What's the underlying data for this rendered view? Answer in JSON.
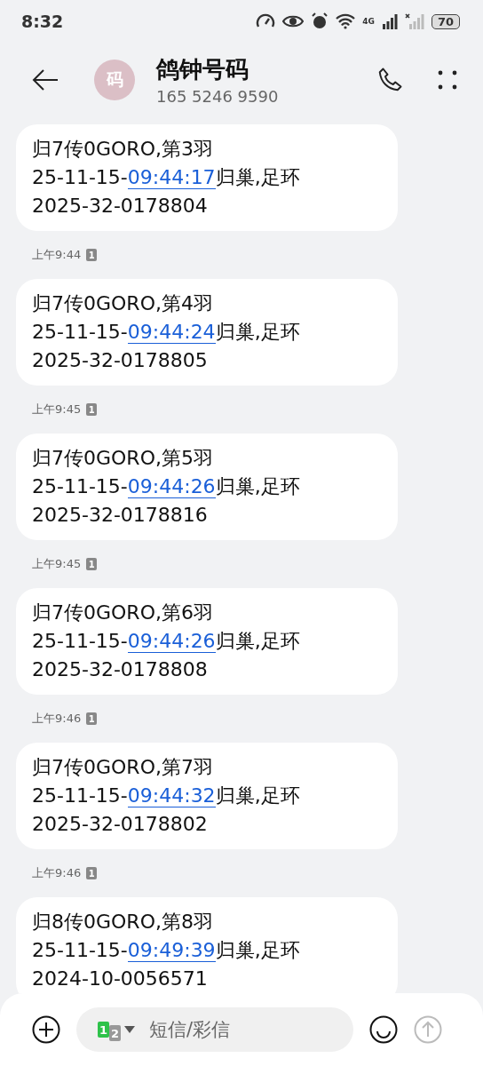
{
  "status_bar": {
    "time": "8:32",
    "network": "4G",
    "battery": "70"
  },
  "header": {
    "avatar": "码",
    "title": "鸽钟号码",
    "subtitle": "165 5246 9590"
  },
  "messages": [
    {
      "line1": "归7传0GORO,第3羽",
      "date": "25-11-15-",
      "time_link": "09:44:17",
      "suffix": "归巢,足环",
      "ring": "2025-32-0178804",
      "sent": "上午9:44",
      "sim": "1"
    },
    {
      "line1": "归7传0GORO,第4羽",
      "date": "25-11-15-",
      "time_link": "09:44:24",
      "suffix": "归巢,足环",
      "ring": "2025-32-0178805",
      "sent": "上午9:45",
      "sim": "1"
    },
    {
      "line1": "归7传0GORO,第5羽",
      "date": "25-11-15-",
      "time_link": "09:44:26",
      "suffix": "归巢,足环",
      "ring": "2025-32-0178816",
      "sent": "上午9:45",
      "sim": "1"
    },
    {
      "line1": "归7传0GORO,第6羽",
      "date": "25-11-15-",
      "time_link": "09:44:26",
      "suffix": "归巢,足环",
      "ring": "2025-32-0178808",
      "sent": "上午9:46",
      "sim": "1"
    },
    {
      "line1": "归7传0GORO,第7羽",
      "date": "25-11-15-",
      "time_link": "09:44:32",
      "suffix": "归巢,足环",
      "ring": "2025-32-0178802",
      "sent": "上午9:46",
      "sim": "1"
    },
    {
      "line1": "归8传0GORO,第8羽",
      "date": "25-11-15-",
      "time_link": "09:49:39",
      "suffix": "归巢,足环",
      "ring": "2024-10-0056571"
    }
  ],
  "composer": {
    "sim_primary": "1",
    "sim_secondary": "2",
    "placeholder": "短信/彩信"
  }
}
